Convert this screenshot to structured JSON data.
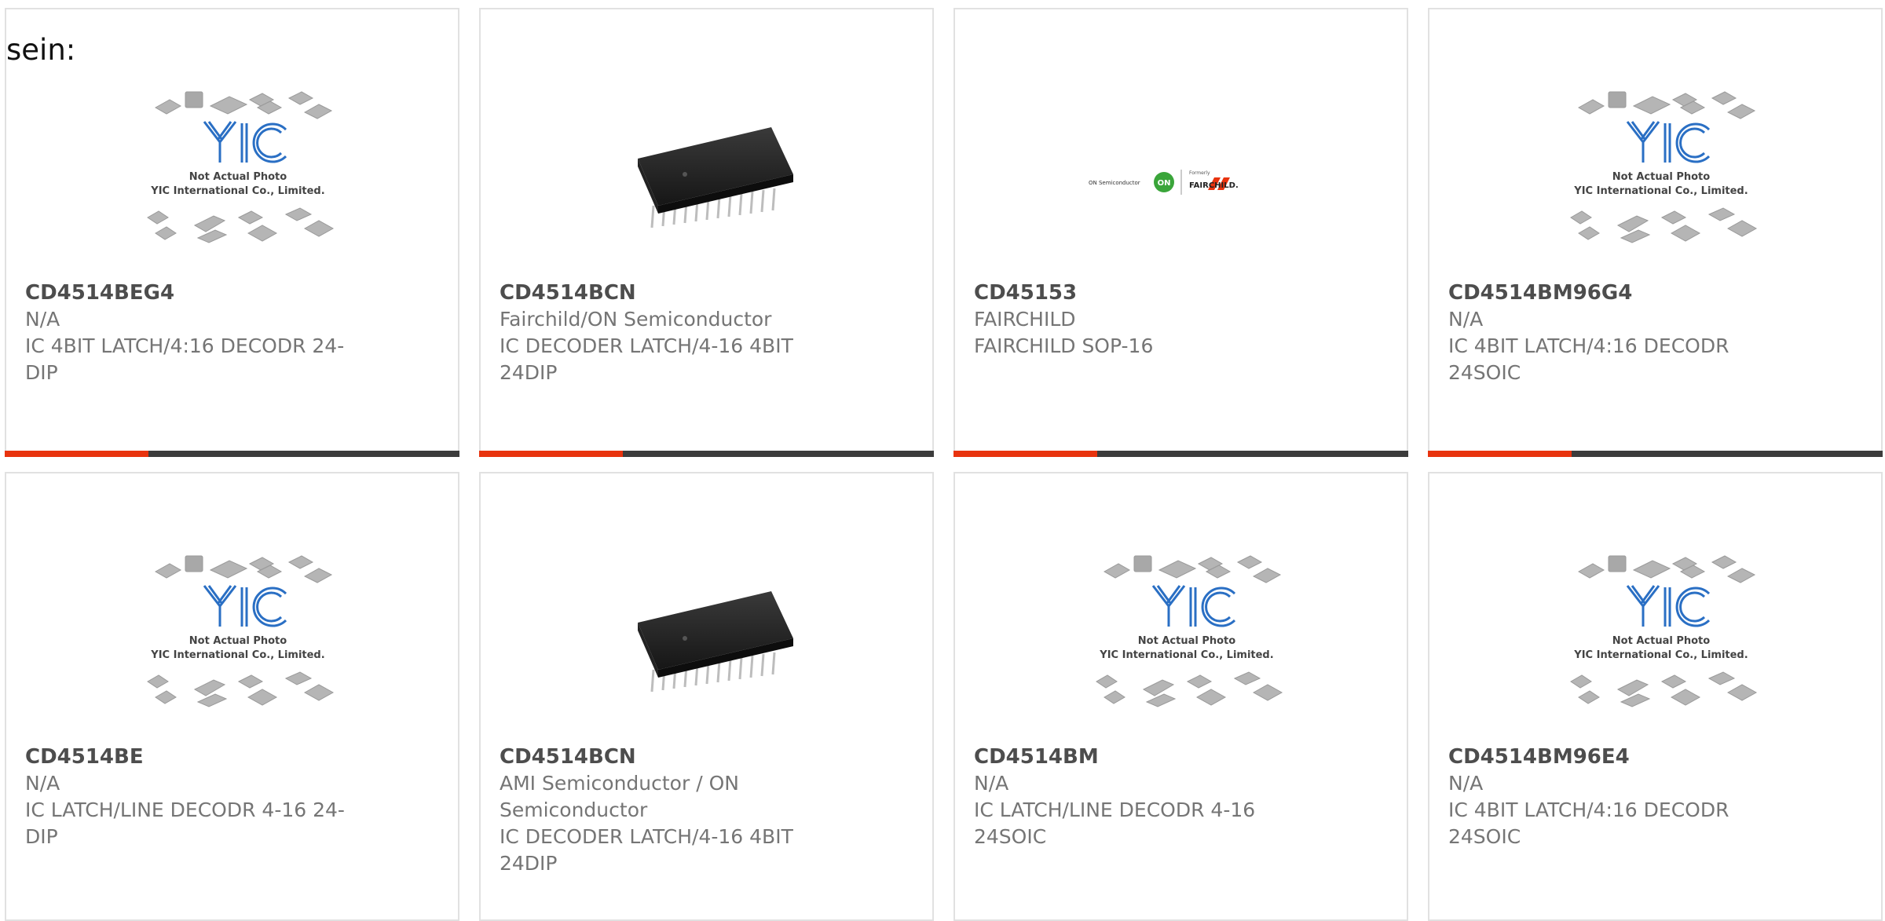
{
  "lead_text": "sein:",
  "accent_color": "#e8330e",
  "placeholder": {
    "line1": "Not Actual Photo",
    "line2": "YIC International Co., Limited.",
    "logo": "YIC"
  },
  "brand_logo": {
    "left": "ON Semiconductor",
    "badge": "ON",
    "right_small": "Formerly",
    "right": "FAIRCHILD."
  },
  "products": [
    {
      "part": "CD4514BEG4",
      "maker": "N/A",
      "desc": "IC 4BIT LATCH/4:16 DECODR 24-\nDIP",
      "image": "placeholder"
    },
    {
      "part": "CD4514BCN",
      "maker": "Fairchild/ON Semiconductor",
      "desc": "IC DECODER LATCH/4-16 4BIT\n24DIP",
      "image": "dip-chip"
    },
    {
      "part": "CD45153",
      "maker": "FAIRCHILD",
      "desc": "FAIRCHILD SOP-16",
      "image": "brand-logo"
    },
    {
      "part": "CD4514BM96G4",
      "maker": "N/A",
      "desc": "IC 4BIT LATCH/4:16 DECODR\n24SOIC",
      "image": "placeholder"
    },
    {
      "part": "CD4514BE",
      "maker": "N/A",
      "desc": "IC LATCH/LINE DECODR 4-16 24-\nDIP",
      "image": "placeholder"
    },
    {
      "part": "CD4514BCN",
      "maker": "AMI Semiconductor / ON\nSemiconductor",
      "desc": "IC DECODER LATCH/4-16 4BIT\n24DIP",
      "image": "dip-chip"
    },
    {
      "part": "CD4514BM",
      "maker": "N/A",
      "desc": "IC LATCH/LINE DECODR 4-16\n24SOIC",
      "image": "placeholder"
    },
    {
      "part": "CD4514BM96E4",
      "maker": "N/A",
      "desc": "IC 4BIT LATCH/4:16 DECODR\n24SOIC",
      "image": "placeholder"
    }
  ]
}
